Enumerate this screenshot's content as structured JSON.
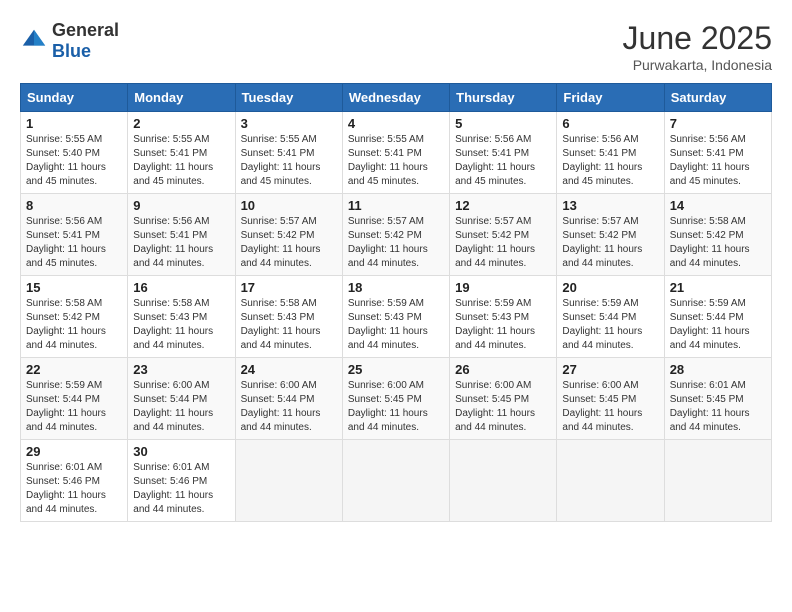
{
  "logo": {
    "general": "General",
    "blue": "Blue"
  },
  "title": "June 2025",
  "location": "Purwakarta, Indonesia",
  "weekdays": [
    "Sunday",
    "Monday",
    "Tuesday",
    "Wednesday",
    "Thursday",
    "Friday",
    "Saturday"
  ],
  "weeks": [
    [
      {
        "day": "1",
        "sunrise": "5:55 AM",
        "sunset": "5:40 PM",
        "daylight": "11 hours and 45 minutes."
      },
      {
        "day": "2",
        "sunrise": "5:55 AM",
        "sunset": "5:41 PM",
        "daylight": "11 hours and 45 minutes."
      },
      {
        "day": "3",
        "sunrise": "5:55 AM",
        "sunset": "5:41 PM",
        "daylight": "11 hours and 45 minutes."
      },
      {
        "day": "4",
        "sunrise": "5:55 AM",
        "sunset": "5:41 PM",
        "daylight": "11 hours and 45 minutes."
      },
      {
        "day": "5",
        "sunrise": "5:56 AM",
        "sunset": "5:41 PM",
        "daylight": "11 hours and 45 minutes."
      },
      {
        "day": "6",
        "sunrise": "5:56 AM",
        "sunset": "5:41 PM",
        "daylight": "11 hours and 45 minutes."
      },
      {
        "day": "7",
        "sunrise": "5:56 AM",
        "sunset": "5:41 PM",
        "daylight": "11 hours and 45 minutes."
      }
    ],
    [
      {
        "day": "8",
        "sunrise": "5:56 AM",
        "sunset": "5:41 PM",
        "daylight": "11 hours and 45 minutes."
      },
      {
        "day": "9",
        "sunrise": "5:56 AM",
        "sunset": "5:41 PM",
        "daylight": "11 hours and 44 minutes."
      },
      {
        "day": "10",
        "sunrise": "5:57 AM",
        "sunset": "5:42 PM",
        "daylight": "11 hours and 44 minutes."
      },
      {
        "day": "11",
        "sunrise": "5:57 AM",
        "sunset": "5:42 PM",
        "daylight": "11 hours and 44 minutes."
      },
      {
        "day": "12",
        "sunrise": "5:57 AM",
        "sunset": "5:42 PM",
        "daylight": "11 hours and 44 minutes."
      },
      {
        "day": "13",
        "sunrise": "5:57 AM",
        "sunset": "5:42 PM",
        "daylight": "11 hours and 44 minutes."
      },
      {
        "day": "14",
        "sunrise": "5:58 AM",
        "sunset": "5:42 PM",
        "daylight": "11 hours and 44 minutes."
      }
    ],
    [
      {
        "day": "15",
        "sunrise": "5:58 AM",
        "sunset": "5:42 PM",
        "daylight": "11 hours and 44 minutes."
      },
      {
        "day": "16",
        "sunrise": "5:58 AM",
        "sunset": "5:43 PM",
        "daylight": "11 hours and 44 minutes."
      },
      {
        "day": "17",
        "sunrise": "5:58 AM",
        "sunset": "5:43 PM",
        "daylight": "11 hours and 44 minutes."
      },
      {
        "day": "18",
        "sunrise": "5:59 AM",
        "sunset": "5:43 PM",
        "daylight": "11 hours and 44 minutes."
      },
      {
        "day": "19",
        "sunrise": "5:59 AM",
        "sunset": "5:43 PM",
        "daylight": "11 hours and 44 minutes."
      },
      {
        "day": "20",
        "sunrise": "5:59 AM",
        "sunset": "5:44 PM",
        "daylight": "11 hours and 44 minutes."
      },
      {
        "day": "21",
        "sunrise": "5:59 AM",
        "sunset": "5:44 PM",
        "daylight": "11 hours and 44 minutes."
      }
    ],
    [
      {
        "day": "22",
        "sunrise": "5:59 AM",
        "sunset": "5:44 PM",
        "daylight": "11 hours and 44 minutes."
      },
      {
        "day": "23",
        "sunrise": "6:00 AM",
        "sunset": "5:44 PM",
        "daylight": "11 hours and 44 minutes."
      },
      {
        "day": "24",
        "sunrise": "6:00 AM",
        "sunset": "5:44 PM",
        "daylight": "11 hours and 44 minutes."
      },
      {
        "day": "25",
        "sunrise": "6:00 AM",
        "sunset": "5:45 PM",
        "daylight": "11 hours and 44 minutes."
      },
      {
        "day": "26",
        "sunrise": "6:00 AM",
        "sunset": "5:45 PM",
        "daylight": "11 hours and 44 minutes."
      },
      {
        "day": "27",
        "sunrise": "6:00 AM",
        "sunset": "5:45 PM",
        "daylight": "11 hours and 44 minutes."
      },
      {
        "day": "28",
        "sunrise": "6:01 AM",
        "sunset": "5:45 PM",
        "daylight": "11 hours and 44 minutes."
      }
    ],
    [
      {
        "day": "29",
        "sunrise": "6:01 AM",
        "sunset": "5:46 PM",
        "daylight": "11 hours and 44 minutes."
      },
      {
        "day": "30",
        "sunrise": "6:01 AM",
        "sunset": "5:46 PM",
        "daylight": "11 hours and 44 minutes."
      },
      null,
      null,
      null,
      null,
      null
    ]
  ]
}
